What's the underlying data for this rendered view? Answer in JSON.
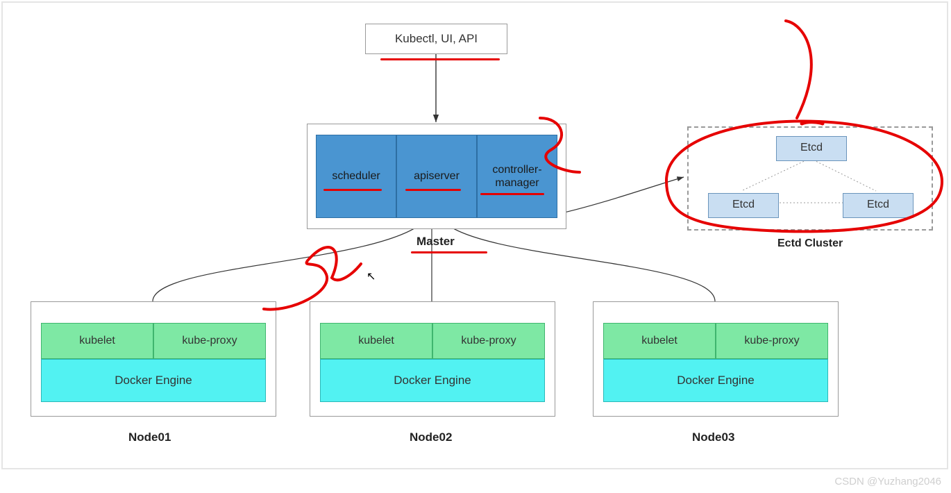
{
  "top": {
    "label": "Kubectl, UI, API"
  },
  "master": {
    "title": "Master",
    "components": {
      "scheduler": "scheduler",
      "apiserver": "apiserver",
      "controller": "controller-manager"
    }
  },
  "nodes": [
    {
      "title": "Node01",
      "kubelet": "kubelet",
      "kubeproxy": "kube-proxy",
      "docker": "Docker Engine"
    },
    {
      "title": "Node02",
      "kubelet": "kubelet",
      "kubeproxy": "kube-proxy",
      "docker": "Docker Engine"
    },
    {
      "title": "Node03",
      "kubelet": "kubelet",
      "kubeproxy": "kube-proxy",
      "docker": "Docker Engine"
    }
  ],
  "etcd": {
    "title": "Ectd Cluster",
    "boxes": [
      "Etcd",
      "Etcd",
      "Etcd"
    ]
  },
  "watermark": "CSDN @Yuzhang2046",
  "colors": {
    "master_fill": "#4a95d1",
    "node_green": "#7ee8a4",
    "node_cyan": "#52f2f2",
    "etcd_fill": "#c9def2",
    "annotation": "#e60000"
  }
}
